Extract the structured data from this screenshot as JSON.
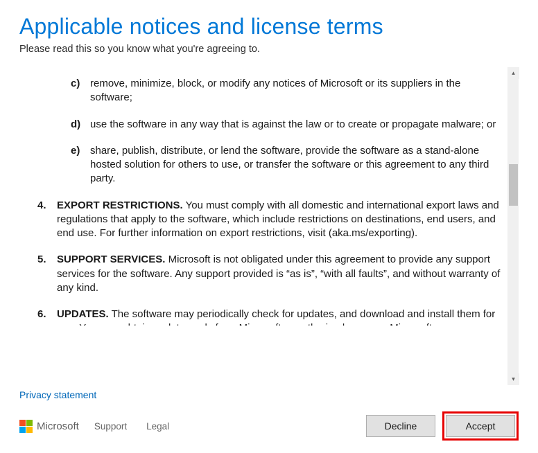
{
  "title": "Applicable notices and license terms",
  "subtitle": "Please read this so you know what you're agreeing to.",
  "sub_items": {
    "c": {
      "letter": "c)",
      "text": "remove, minimize, block, or modify any notices of Microsoft or its suppliers in the software;"
    },
    "d": {
      "letter": "d)",
      "text": "use the software in any way that is against the law or to create or propagate malware; or"
    },
    "e": {
      "letter": "e)",
      "text": "share, publish, distribute, or lend the software, provide the software as a stand-alone hosted solution for others to use, or transfer the software or this agreement to any third party."
    }
  },
  "main_items": {
    "item4": {
      "num": "4.",
      "heading": "EXPORT RESTRICTIONS.",
      "text": " You must comply with all domestic and international export laws and regulations that apply to the software, which include restrictions on destinations, end users, and end use. For further information on export restrictions, visit (aka.ms/exporting)."
    },
    "item5": {
      "num": "5.",
      "heading": "SUPPORT SERVICES.",
      "text": " Microsoft is not obligated under this agreement to provide any support services for the software. Any support provided is “as is”, “with all faults”, and without warranty of any kind."
    },
    "item6": {
      "num": "6.",
      "heading": "UPDATES.",
      "text": " The software may periodically check for updates, and download and install them for you. You may obtain updates only from Microsoft or authorized sources. Microsoft"
    }
  },
  "privacy_link": "Privacy statement",
  "footer": {
    "brand": "Microsoft",
    "support": "Support",
    "legal": "Legal"
  },
  "buttons": {
    "decline": "Decline",
    "accept": "Accept"
  }
}
